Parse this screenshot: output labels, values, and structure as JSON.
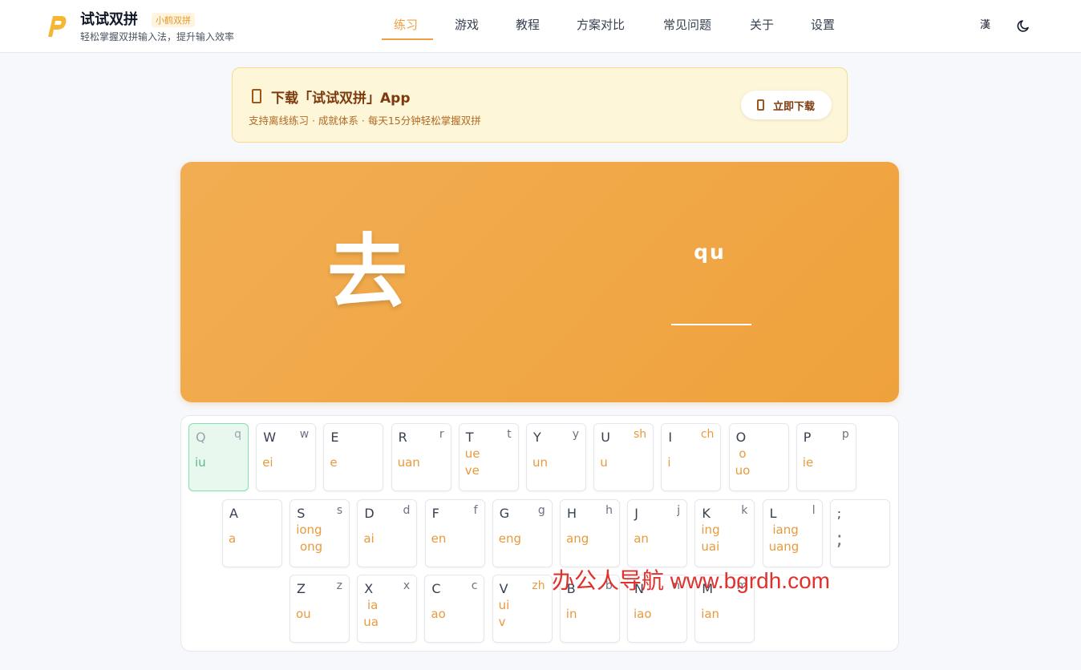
{
  "header": {
    "title": "试试双拼",
    "badge": "小鹤双拼",
    "subtitle": "轻松掌握双拼输入法，提升输入效率",
    "nav": [
      "练习",
      "游戏",
      "教程",
      "方案对比",
      "常见问题",
      "关于",
      "设置"
    ],
    "active_nav": "练习",
    "lang_toggle": "漢"
  },
  "banner": {
    "title": "下载「试试双拼」App",
    "subtitle": "支持离线练习 · 成就体系 · 每天15分钟轻松掌握双拼",
    "button": "立即下载"
  },
  "practice": {
    "character": "去",
    "pinyin": "qu"
  },
  "keyboard": {
    "rows": [
      [
        {
          "up": "Q",
          "lo": "q",
          "fin": [
            "iu"
          ],
          "highlight": true
        },
        {
          "up": "W",
          "lo": "w",
          "fin": [
            "ei"
          ]
        },
        {
          "up": "E",
          "lo": "",
          "fin": [
            "e"
          ]
        },
        {
          "up": "R",
          "lo": "r",
          "fin": [
            "uan"
          ]
        },
        {
          "up": "T",
          "lo": "t",
          "fin": [
            "ue",
            "ve"
          ]
        },
        {
          "up": "Y",
          "lo": "y",
          "fin": [
            "un"
          ]
        },
        {
          "up": "U",
          "lo": "sh",
          "fin": [
            "u"
          ]
        },
        {
          "up": "I",
          "lo": "ch",
          "fin": [
            "i"
          ]
        },
        {
          "up": "O",
          "lo": "",
          "fin": [
            " o",
            "uo"
          ]
        },
        {
          "up": "P",
          "lo": "p",
          "fin": [
            "ie"
          ]
        }
      ],
      [
        {
          "up": "A",
          "lo": "",
          "fin": [
            "a"
          ]
        },
        {
          "up": "S",
          "lo": "s",
          "fin": [
            "iong",
            " ong"
          ]
        },
        {
          "up": "D",
          "lo": "d",
          "fin": [
            "ai"
          ]
        },
        {
          "up": "F",
          "lo": "f",
          "fin": [
            "en"
          ]
        },
        {
          "up": "G",
          "lo": "g",
          "fin": [
            "eng"
          ]
        },
        {
          "up": "H",
          "lo": "h",
          "fin": [
            "ang"
          ]
        },
        {
          "up": "J",
          "lo": "j",
          "fin": [
            "an"
          ]
        },
        {
          "up": "K",
          "lo": "k",
          "fin": [
            "ing",
            "uai"
          ]
        },
        {
          "up": "L",
          "lo": "l",
          "fin": [
            " iang",
            "uang"
          ]
        },
        {
          "up": ";",
          "lo": "",
          "fin": [
            ";"
          ]
        }
      ],
      [
        {
          "up": "Z",
          "lo": "z",
          "fin": [
            "ou"
          ]
        },
        {
          "up": "X",
          "lo": "x",
          "fin": [
            " ia",
            "ua"
          ]
        },
        {
          "up": "C",
          "lo": "c",
          "fin": [
            "ao"
          ]
        },
        {
          "up": "V",
          "lo": "zh",
          "fin": [
            "ui",
            "v"
          ]
        },
        {
          "up": "B",
          "lo": "b",
          "fin": [
            "in"
          ]
        },
        {
          "up": "N",
          "lo": "n",
          "fin": [
            "iao"
          ]
        },
        {
          "up": "M",
          "lo": "m",
          "fin": [
            "ian"
          ]
        }
      ]
    ]
  },
  "watermark": "办公人导航 www.bgrdh.com",
  "colors": {
    "accent": "#f0a040",
    "card": "#efa23c",
    "highlight": "#e8f8ef"
  }
}
